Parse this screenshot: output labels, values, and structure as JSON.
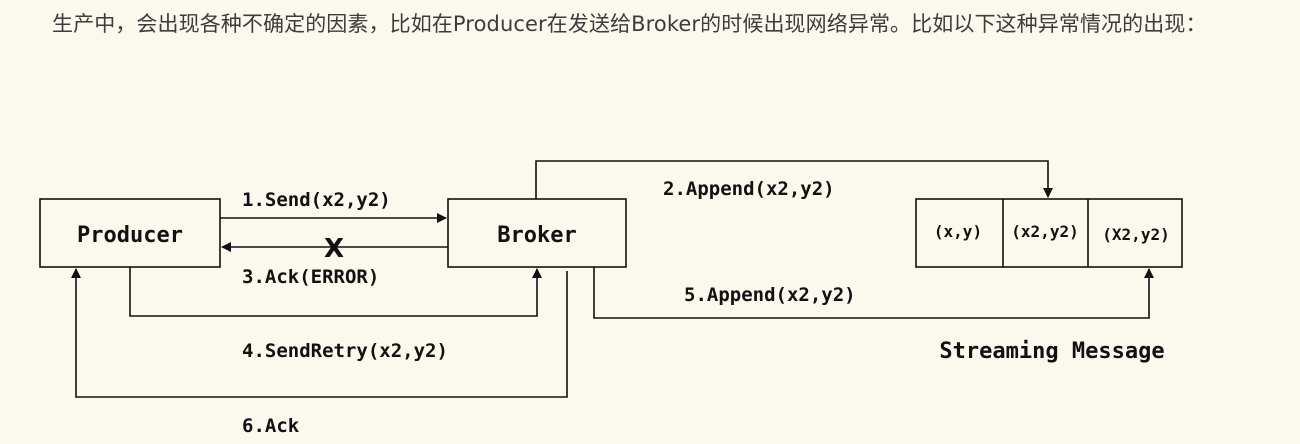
{
  "article": {
    "paragraph": "生产中，会出现各种不确定的因素，比如在Producer在发送给Broker的时候出现网络异常。比如以下这种异常情况的出现："
  },
  "diagram": {
    "producer_label": "Producer",
    "broker_label": "Broker",
    "stream_caption": "Streaming Message",
    "cells": [
      "(x,y)",
      "(x2,y2)",
      "(X2,y2)"
    ],
    "failure_mark": "X",
    "edges": {
      "send": "1.Send(x2,y2)",
      "append_first": "2.Append(x2,y2)",
      "ack_error": "3.Ack(ERROR)",
      "send_retry": "4.SendRetry(x2,y2)",
      "append_retry": "5.Append(x2,y2)",
      "ack": "6.Ack"
    }
  }
}
